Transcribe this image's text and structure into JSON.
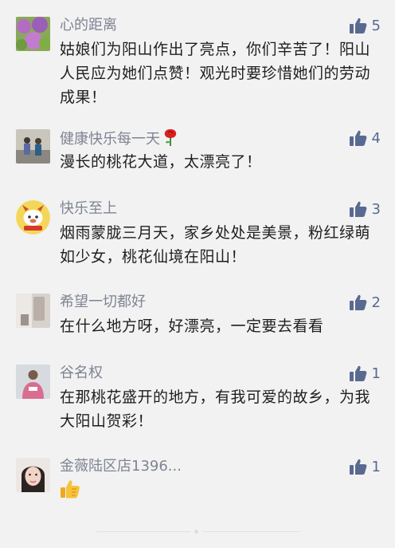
{
  "comments": [
    {
      "name": "心的距离",
      "likes": "5",
      "text": "姑娘们为阳山作出了亮点，你们辛苦了！阳山人民应为她们点赞！观光时要珍惜她们的劳动成果！"
    },
    {
      "name": "健康快乐每一天",
      "likes": "4",
      "text": "漫长的桃花大道，太漂亮了！"
    },
    {
      "name": "快乐至上",
      "likes": "3",
      "text": "烟雨蒙胧三月天，家乡处处是美景，粉红绿萌如少女，桃花仙境在阳山！"
    },
    {
      "name": "希望一切都好",
      "likes": "2",
      "text": "在什么地方呀，好漂亮，一定要去看看"
    },
    {
      "name": "谷名权",
      "likes": "1",
      "text": "在那桃花盛开的地方，有我可爱的故乡，为我大阳山贺彩！"
    },
    {
      "name": "金薇陆区店1396...",
      "likes": "1",
      "text": ""
    }
  ],
  "colors": {
    "background": "#f2f2f2",
    "nickname": "#7f8493",
    "like": "#596a91",
    "text": "#1f1f1f"
  }
}
